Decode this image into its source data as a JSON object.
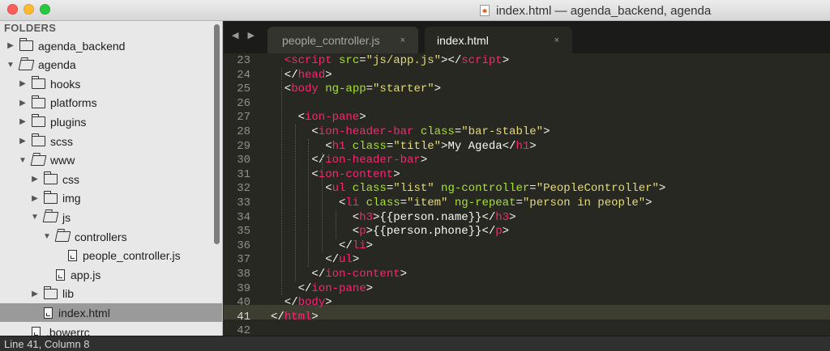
{
  "window": {
    "title": "index.html — agenda_backend, agenda",
    "traffic_lights": [
      "close",
      "minimize",
      "maximize"
    ]
  },
  "sidebar": {
    "header": "FOLDERS",
    "tree": [
      {
        "label": "agenda_backend",
        "type": "folder",
        "expanded": false
      },
      {
        "label": "agenda",
        "type": "folder",
        "expanded": true
      },
      {
        "label": "hooks",
        "type": "folder",
        "expanded": false
      },
      {
        "label": "platforms",
        "type": "folder",
        "expanded": false
      },
      {
        "label": "plugins",
        "type": "folder",
        "expanded": false
      },
      {
        "label": "scss",
        "type": "folder",
        "expanded": false
      },
      {
        "label": "www",
        "type": "folder",
        "expanded": true
      },
      {
        "label": "css",
        "type": "folder",
        "expanded": false
      },
      {
        "label": "img",
        "type": "folder",
        "expanded": false
      },
      {
        "label": "js",
        "type": "folder",
        "expanded": true
      },
      {
        "label": "controllers",
        "type": "folder",
        "expanded": true
      },
      {
        "label": "people_controller.js",
        "type": "file"
      },
      {
        "label": "app.js",
        "type": "file"
      },
      {
        "label": "lib",
        "type": "folder",
        "expanded": false
      },
      {
        "label": "index.html",
        "type": "file",
        "selected": true
      },
      {
        "label": ".bowerrc",
        "type": "file"
      }
    ]
  },
  "tabs": [
    {
      "label": "people_controller.js",
      "active": false,
      "close": "×"
    },
    {
      "label": "index.html",
      "active": true,
      "close": "×"
    }
  ],
  "editor": {
    "current_line": 41,
    "lines": [
      {
        "n": "23",
        "indent": 1,
        "parts": [
          [
            "tg",
            "<script"
          ],
          [
            "at",
            " src"
          ],
          [
            "",
            "="
          ],
          [
            "st",
            "\"js/app.js\""
          ],
          [
            "",
            "></"
          ],
          [
            "tg",
            "script"
          ],
          [
            "",
            ">"
          ]
        ]
      },
      {
        "n": "24",
        "indent": 1,
        "parts": [
          [
            "",
            "</"
          ],
          [
            "tg",
            "head"
          ],
          [
            "",
            ">"
          ]
        ]
      },
      {
        "n": "25",
        "indent": 1,
        "parts": [
          [
            "",
            "<"
          ],
          [
            "tg",
            "body"
          ],
          [
            "at",
            " ng-app"
          ],
          [
            "",
            "="
          ],
          [
            "st",
            "\"starter\""
          ],
          [
            "",
            ">"
          ]
        ]
      },
      {
        "n": "26",
        "indent": 0,
        "parts": []
      },
      {
        "n": "27",
        "indent": 2,
        "parts": [
          [
            "",
            "<"
          ],
          [
            "tg",
            "ion-pane"
          ],
          [
            "",
            ">"
          ]
        ]
      },
      {
        "n": "28",
        "indent": 3,
        "parts": [
          [
            "",
            "<"
          ],
          [
            "tg",
            "ion-header-bar"
          ],
          [
            "at",
            " class"
          ],
          [
            "",
            "="
          ],
          [
            "st",
            "\"bar-stable\""
          ],
          [
            "",
            ">"
          ]
        ]
      },
      {
        "n": "29",
        "indent": 4,
        "parts": [
          [
            "",
            "<"
          ],
          [
            "tg",
            "h1"
          ],
          [
            "at",
            " class"
          ],
          [
            "",
            "="
          ],
          [
            "st",
            "\"title\""
          ],
          [
            "",
            ">My Ageda</"
          ],
          [
            "tg",
            "h1"
          ],
          [
            "",
            ">"
          ]
        ]
      },
      {
        "n": "30",
        "indent": 3,
        "parts": [
          [
            "",
            "</"
          ],
          [
            "tg",
            "ion-header-bar"
          ],
          [
            "",
            ">"
          ]
        ]
      },
      {
        "n": "31",
        "indent": 3,
        "parts": [
          [
            "",
            "<"
          ],
          [
            "tg",
            "ion-content"
          ],
          [
            "",
            ">"
          ]
        ]
      },
      {
        "n": "32",
        "indent": 4,
        "parts": [
          [
            "",
            "<"
          ],
          [
            "tg",
            "ul"
          ],
          [
            "at",
            " class"
          ],
          [
            "",
            "="
          ],
          [
            "st",
            "\"list\""
          ],
          [
            "at",
            " ng-controller"
          ],
          [
            "",
            "="
          ],
          [
            "st",
            "\"PeopleController\""
          ],
          [
            "",
            ">"
          ]
        ]
      },
      {
        "n": "33",
        "indent": 5,
        "parts": [
          [
            "",
            "<"
          ],
          [
            "tg",
            "li"
          ],
          [
            "at",
            " class"
          ],
          [
            "",
            "="
          ],
          [
            "st",
            "\"item\""
          ],
          [
            "at",
            " ng-repeat"
          ],
          [
            "",
            "="
          ],
          [
            "st",
            "\"person in people\""
          ],
          [
            "",
            ">"
          ]
        ]
      },
      {
        "n": "34",
        "indent": 6,
        "parts": [
          [
            "",
            "<"
          ],
          [
            "tg",
            "h3"
          ],
          [
            "",
            ">{{person.name}}</"
          ],
          [
            "tg",
            "h3"
          ],
          [
            "",
            ">"
          ]
        ]
      },
      {
        "n": "35",
        "indent": 6,
        "parts": [
          [
            "",
            "<"
          ],
          [
            "tg",
            "p"
          ],
          [
            "",
            ">{{person.phone}}</"
          ],
          [
            "tg",
            "p"
          ],
          [
            "",
            ">"
          ]
        ]
      },
      {
        "n": "36",
        "indent": 5,
        "parts": [
          [
            "",
            "</"
          ],
          [
            "tg",
            "li"
          ],
          [
            "",
            ">"
          ]
        ]
      },
      {
        "n": "37",
        "indent": 4,
        "parts": [
          [
            "",
            "</"
          ],
          [
            "tg",
            "ul"
          ],
          [
            "",
            ">"
          ]
        ]
      },
      {
        "n": "38",
        "indent": 3,
        "parts": [
          [
            "",
            "</"
          ],
          [
            "tg",
            "ion-content"
          ],
          [
            "",
            ">"
          ]
        ]
      },
      {
        "n": "39",
        "indent": 2,
        "parts": [
          [
            "",
            "</"
          ],
          [
            "tg",
            "ion-pane"
          ],
          [
            "",
            ">"
          ]
        ]
      },
      {
        "n": "40",
        "indent": 1,
        "parts": [
          [
            "",
            "</"
          ],
          [
            "tg",
            "body"
          ],
          [
            "",
            ">"
          ]
        ]
      },
      {
        "n": "41",
        "indent": 0,
        "parts": [
          [
            "",
            "</"
          ],
          [
            "tg",
            "html"
          ],
          [
            "",
            ">"
          ]
        ]
      },
      {
        "n": "42",
        "indent": 0,
        "parts": []
      }
    ]
  },
  "status": {
    "text": "Line 41, Column 8"
  },
  "colors": {
    "editor_bg": "#272822",
    "tag": "#f92672",
    "attribute": "#a6e22e",
    "string": "#e6db74",
    "text": "#f8f8f2"
  }
}
